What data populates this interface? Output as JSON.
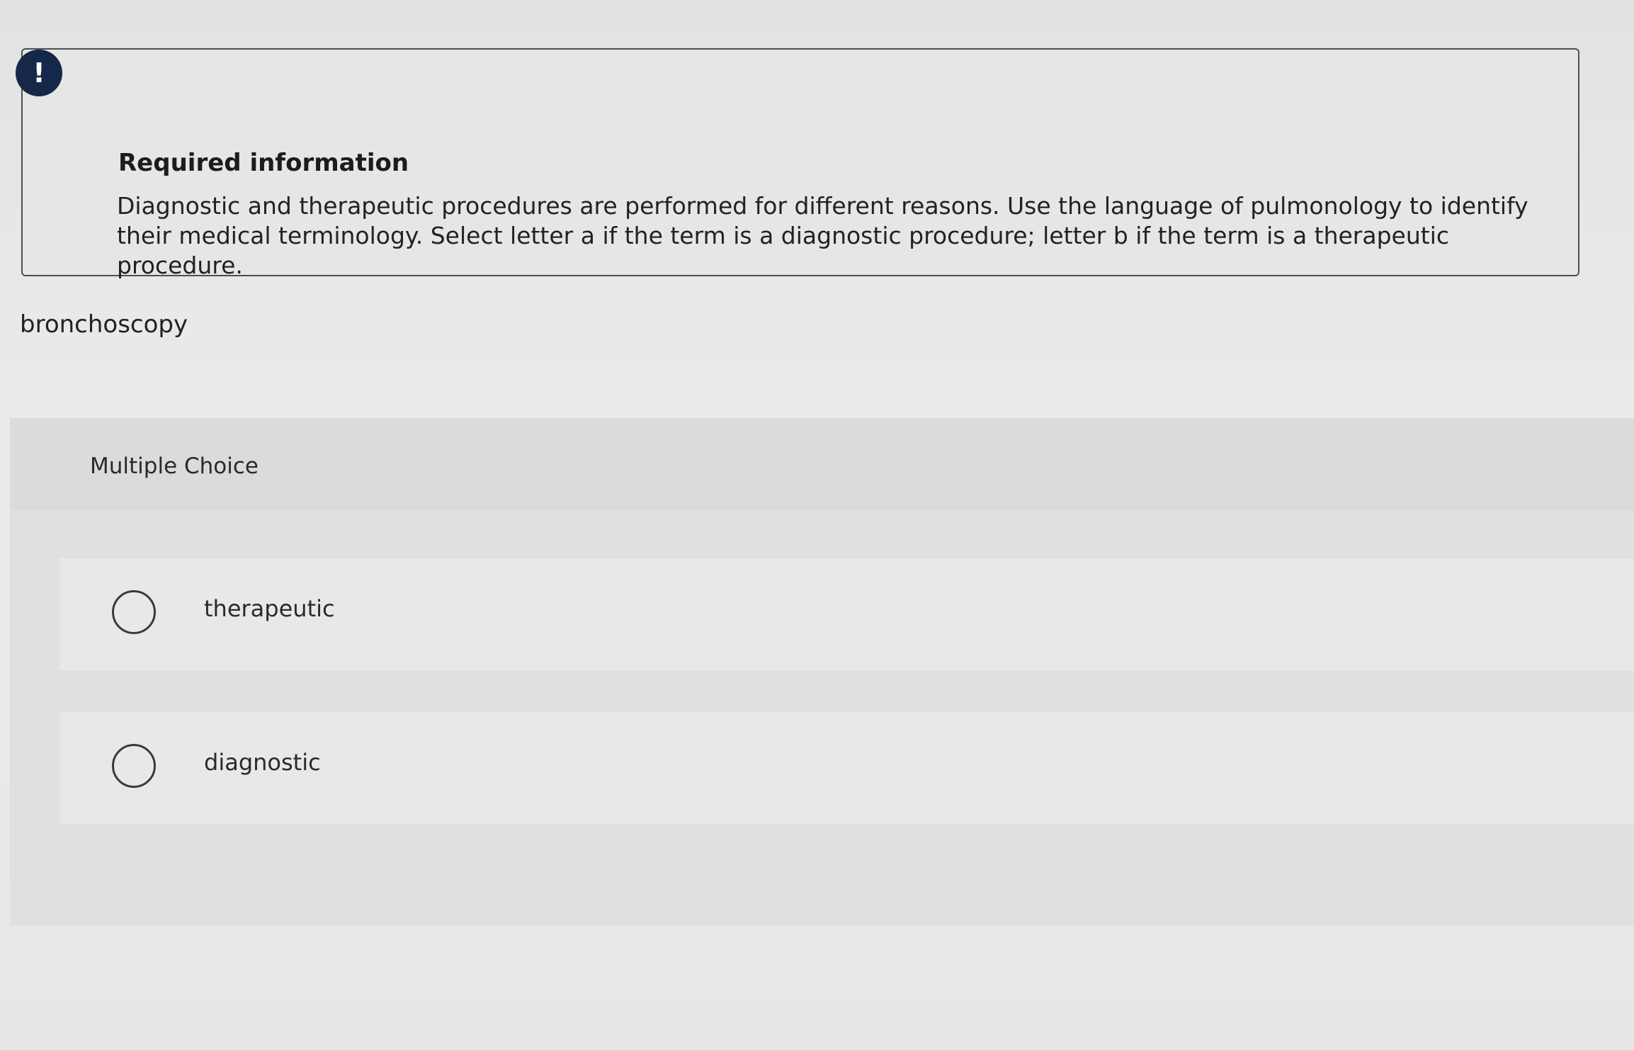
{
  "notice": {
    "icon": "exclamation-icon",
    "icon_glyph": "!",
    "title": "Required information",
    "body": "Diagnostic and therapeutic procedures are performed for different reasons. Use the language of pulmonology to identify their medical terminology. Select letter a if the term is a diagnostic procedure; letter b if the term is a therapeutic procedure."
  },
  "question": {
    "term": "bronchoscopy"
  },
  "multiple_choice": {
    "label": "Multiple Choice",
    "options": [
      {
        "label": "therapeutic",
        "selected": false
      },
      {
        "label": "diagnostic",
        "selected": false
      }
    ]
  }
}
